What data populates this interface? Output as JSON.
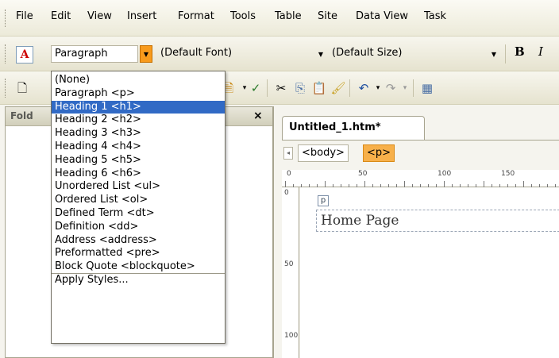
{
  "menubar": {
    "items": [
      "File",
      "Edit",
      "View",
      "Insert",
      "Format",
      "Tools",
      "Table",
      "Site",
      "Data View",
      "Task"
    ]
  },
  "format_toolbar": {
    "style_value": "Paragraph",
    "font_value": "(Default Font)",
    "size_value": "(Default Size)",
    "bold_label": "B",
    "italic_label": "I",
    "style_icon": "A"
  },
  "folder_panel": {
    "title": "Fold",
    "close_label": "×"
  },
  "editor": {
    "tab_title": "Untitled_1.htm*",
    "tags": [
      "<body>",
      "<p>"
    ],
    "ruler_top": [
      "0",
      "50",
      "100",
      "150"
    ],
    "ruler_left": [
      "0",
      "50",
      "100"
    ],
    "p_marker": "p",
    "content_text": "Home Page"
  },
  "dropdown": {
    "items": [
      "(None)",
      "Paragraph <p>",
      "Heading 1 <h1>",
      "Heading 2 <h2>",
      "Heading 3 <h3>",
      "Heading 4 <h4>",
      "Heading 5 <h5>",
      "Heading 6 <h6>",
      "Unordered List <ul>",
      "Ordered List <ol>",
      "Defined Term <dt>",
      "Definition <dd>",
      "Address <address>",
      "Preformatted <pre>",
      "Block Quote <blockquote>",
      "Apply Styles..."
    ],
    "highlighted": "Heading 1 <h1>"
  },
  "colors": {
    "highlight": "#316ac5",
    "active_tag": "#f7b04a",
    "combo_button": "#f89b1c"
  }
}
